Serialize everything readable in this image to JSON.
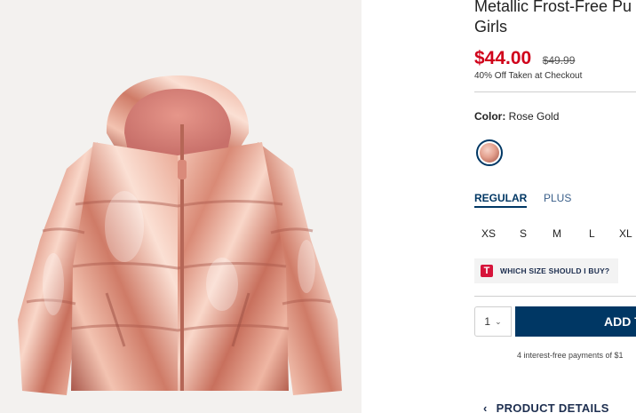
{
  "product": {
    "title_line1": "Metallic Frost-Free Pu",
    "title_line2": "Girls",
    "sale_price": "$44.00",
    "original_price": "$49.99",
    "promo_text": "40% Off Taken at Checkout"
  },
  "color": {
    "label": "Color:",
    "value": "Rose Gold",
    "swatch_icon": "rose-gold-swatch"
  },
  "fit": {
    "tabs": [
      "REGULAR",
      "PLUS"
    ],
    "selected": "REGULAR"
  },
  "sizes": [
    "XS",
    "S",
    "M",
    "L",
    "XL"
  ],
  "size_guide": {
    "badge": "T",
    "label": "WHICH SIZE SHOULD I BUY?"
  },
  "cart": {
    "quantity": "1",
    "add_label": "ADD T",
    "installment_text": "4 interest-free payments of $1"
  },
  "details": {
    "label": "PRODUCT DETAILS"
  },
  "colors": {
    "sale_red": "#d0021b",
    "navy": "#003764",
    "rose_gold": "#e3a08e"
  }
}
